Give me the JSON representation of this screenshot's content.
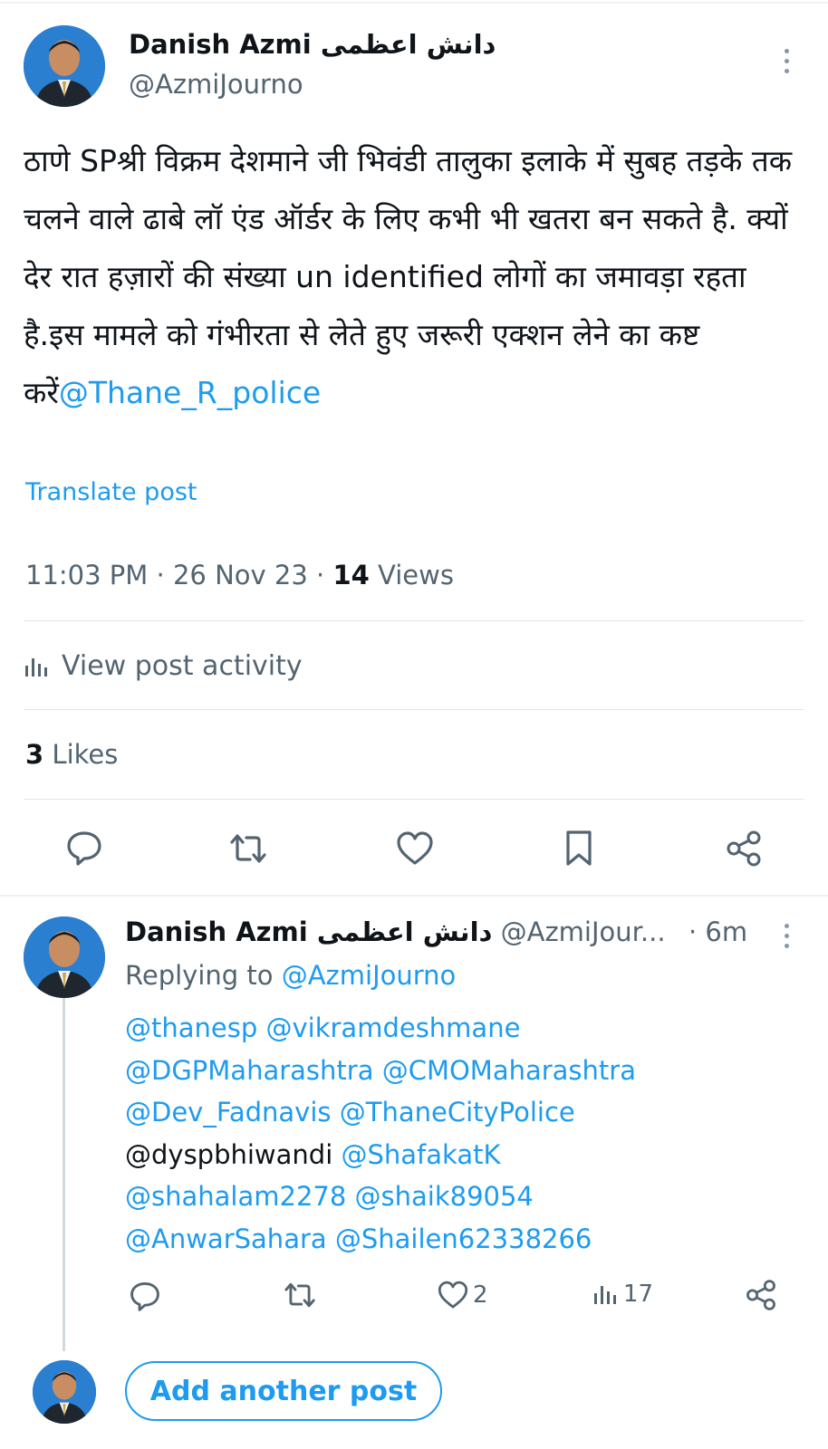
{
  "post": {
    "author_name": "Danish Azmi دانش اعظمی",
    "author_handle": "@AzmiJourno",
    "text_main": "ठाणे SPश्री विक्रम देशमाने जी भिवंडी तालुका इलाके में सुबह तड़के तक चलने वाले ढाबे लॉ एंड ऑर्डर के लिए कभी भी खतरा बन सकते है. क्यों देर रात हज़ारों की संख्या un identified लोगों का जमावड़ा रहता है.इस मामले को गंभीरता से लेते हुए जरूरी एक्शन लेने का कष्ट करें",
    "text_mention": "@Thane_R_police",
    "translate_label": "Translate post",
    "time": "11:03 PM",
    "date": "26 Nov 23",
    "views_count": "14",
    "views_label": "Views",
    "activity_label": "View post activity",
    "likes_count": "3",
    "likes_label": "Likes"
  },
  "reply": {
    "author_name": "Danish Azmi دانش اعظمی",
    "author_handle": "@AzmiJour...",
    "age": "· 6m",
    "replying_prefix": "Replying to",
    "replying_handle": "@AzmiJourno",
    "mentions": [
      "@thanesp",
      "@vikramdeshmane",
      "@DGPMaharashtra",
      "@CMOMaharashtra",
      "@Dev_Fadnavis",
      "@ThaneCityPolice",
      "@dyspbhiwandi",
      "@ShafakatK",
      "@shahalam2278",
      "@shaik89054",
      "@AnwarSahara",
      "@Shailen62338266"
    ],
    "like_count": "2",
    "views_count": "17"
  },
  "composer": {
    "add_label": "Add another post"
  },
  "icons": {
    "more": "more-vertical-icon",
    "reply": "reply-icon",
    "repost": "repost-icon",
    "like": "heart-icon",
    "bookmark": "bookmark-icon",
    "share": "share-icon",
    "views": "bar-chart-icon"
  },
  "colors": {
    "accent": "#1d9bf0",
    "text": "#0f1419",
    "muted": "#536471",
    "divider": "#e1e6ea"
  }
}
